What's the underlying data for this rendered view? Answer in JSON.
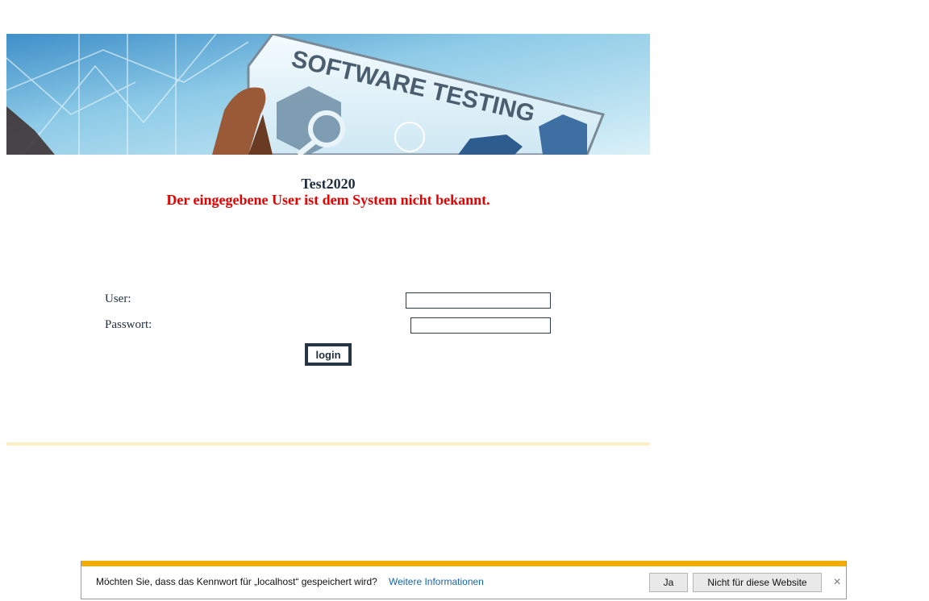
{
  "banner": {
    "text": "SOFTWARE TESTING"
  },
  "header": {
    "title": "Test2020",
    "error": "Der eingegebene User ist dem System nicht bekannt."
  },
  "form": {
    "user_label": "User:",
    "user_value": "",
    "password_label": "Passwort:",
    "password_value": "",
    "login_label": "login"
  },
  "password_prompt": {
    "message": "Möchten Sie, dass das Kennwort für „localhost“ gespeichert wird?",
    "link": "Weitere Informationen",
    "yes_label": "Ja",
    "no_label": "Nicht für diese Website",
    "close_glyph": "×"
  },
  "colors": {
    "error": "#e60000",
    "accent_bar": "#f2ac00",
    "divider": "#fbf0c4",
    "link": "#1565b0"
  }
}
